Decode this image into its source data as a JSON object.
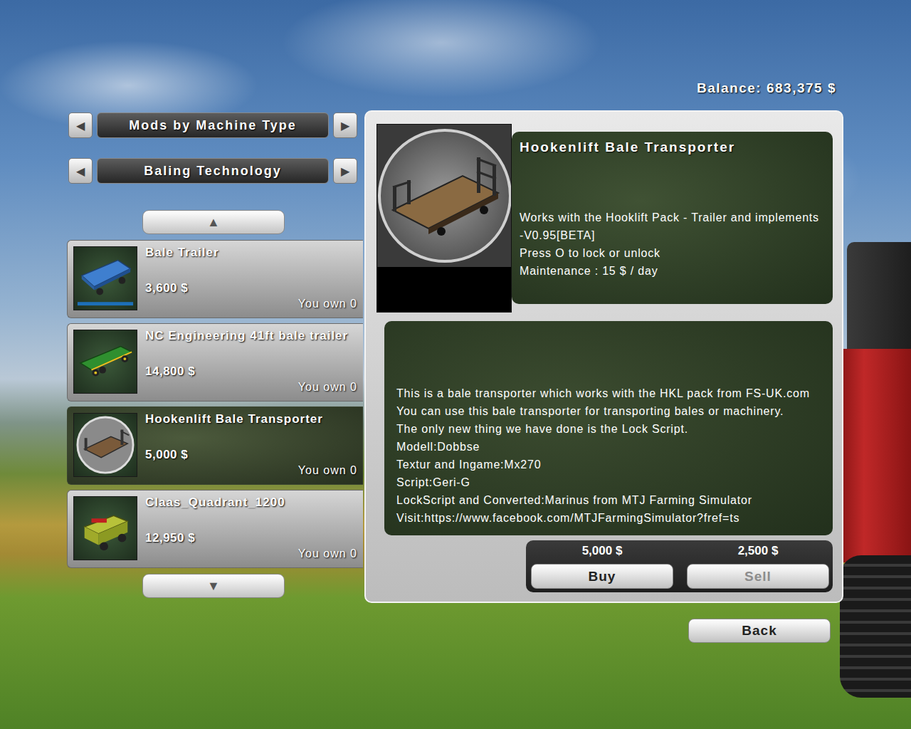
{
  "balance": "Balance: 683,375 $",
  "selectors": [
    {
      "label": "Mods by Machine Type",
      "prev": "◀",
      "next": "▶"
    },
    {
      "label": "Baling Technology",
      "prev": "◀",
      "next": "▶"
    }
  ],
  "list": {
    "up": "▲",
    "down": "▼",
    "items": [
      {
        "title": "Bale Trailer",
        "price": "3,600 $",
        "owned": "You own 0",
        "selected": false,
        "kind": "blue-trailer"
      },
      {
        "title": "NC Engineering 41ft bale trailer",
        "price": "14,800 $",
        "owned": "You own 0",
        "selected": false,
        "kind": "green-trailer"
      },
      {
        "title": "Hookenlift Bale Transporter",
        "price": "5,000 $",
        "owned": "You own 0",
        "selected": true,
        "kind": "logo-flatbed"
      },
      {
        "title": "Claas_Quadrant_1200",
        "price": "12,950 $",
        "owned": "You own 0",
        "selected": false,
        "kind": "baler"
      }
    ]
  },
  "detail": {
    "title": "Hookenlift Bale Transporter",
    "info": [
      "Works with the Hooklift Pack - Trailer and implements -V0.95[BETA]",
      "Press O to lock or unlock",
      "Maintenance : 15 $ / day"
    ],
    "description": [
      "This is a bale transporter which works with the HKL pack from FS-UK.com",
      "You can use this bale transporter for transporting bales or machinery.",
      "The only new thing we have done is the Lock Script.",
      "Modell:Dobbse",
      "Textur and Ingame:Mx270",
      "Script:Geri-G",
      "LockScript and Converted:Marinus from MTJ Farming Simulator",
      "Visit:https://www.facebook.com/MTJFarmingSimulator?fref=ts"
    ],
    "buy": {
      "price": "5,000 $",
      "label": "Buy",
      "disabled": false
    },
    "sell": {
      "price": "2,500 $",
      "label": "Sell",
      "disabled": true
    }
  },
  "back": "Back"
}
